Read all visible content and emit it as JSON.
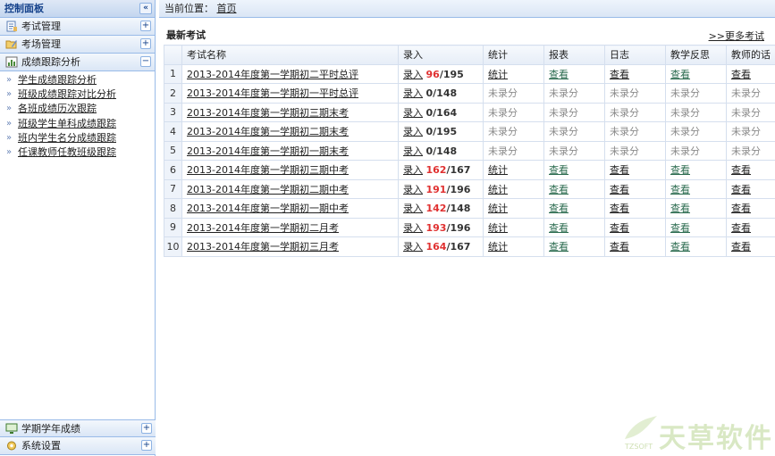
{
  "sidebar": {
    "header": "控制面板",
    "collapse_symbol": "«",
    "sections": [
      {
        "label": "考试管理",
        "toggle": "+"
      },
      {
        "label": "考场管理",
        "toggle": "+"
      },
      {
        "label": "成绩跟踪分析",
        "toggle": "−"
      }
    ],
    "links": [
      "学生成绩跟踪分析",
      "班级成绩跟踪对比分析",
      "各班成绩历次跟踪",
      "班级学生单科成绩跟踪",
      "班内学生名分成绩跟踪",
      "任课教师任教班级跟踪"
    ],
    "bottom_sections": [
      {
        "label": "学期学年成绩",
        "toggle": "+"
      },
      {
        "label": "系统设置",
        "toggle": "+"
      }
    ]
  },
  "breadcrumb": {
    "label": "当前位置：",
    "home": "首页"
  },
  "panel": {
    "title": "最新考试",
    "more_link": ">>更多考试"
  },
  "table": {
    "headers": [
      "考试名称",
      "录入",
      "统计",
      "报表",
      "日志",
      "教学反思",
      "教师的话"
    ],
    "rows": [
      {
        "num": "1",
        "name": "2013-2014年度第一学期初二平时总评",
        "entry": "录入",
        "done": "96",
        "total": "/195",
        "done_red": true,
        "stat": "统计",
        "report": "查看",
        "log": "查看",
        "reflect": "查看",
        "talk": "查看",
        "recorded": true
      },
      {
        "num": "2",
        "name": "2013-2014年度第一学期初一平时总评",
        "entry": "录入",
        "done": "0",
        "total": "/148",
        "done_red": false,
        "stat": "未录分",
        "report": "未录分",
        "log": "未录分",
        "reflect": "未录分",
        "talk": "未录分",
        "recorded": false
      },
      {
        "num": "3",
        "name": "2013-2014年度第一学期初三期末考",
        "entry": "录入",
        "done": "0",
        "total": "/164",
        "done_red": false,
        "stat": "未录分",
        "report": "未录分",
        "log": "未录分",
        "reflect": "未录分",
        "talk": "未录分",
        "recorded": false
      },
      {
        "num": "4",
        "name": "2013-2014年度第一学期初二期末考",
        "entry": "录入",
        "done": "0",
        "total": "/195",
        "done_red": false,
        "stat": "未录分",
        "report": "未录分",
        "log": "未录分",
        "reflect": "未录分",
        "talk": "未录分",
        "recorded": false
      },
      {
        "num": "5",
        "name": "2013-2014年度第一学期初一期末考",
        "entry": "录入",
        "done": "0",
        "total": "/148",
        "done_red": false,
        "stat": "未录分",
        "report": "未录分",
        "log": "未录分",
        "reflect": "未录分",
        "talk": "未录分",
        "recorded": false
      },
      {
        "num": "6",
        "name": "2013-2014年度第一学期初三期中考",
        "entry": "录入",
        "done": "162",
        "total": "/167",
        "done_red": true,
        "stat": "统计",
        "report": "查看",
        "log": "查看",
        "reflect": "查看",
        "talk": "查看",
        "recorded": true
      },
      {
        "num": "7",
        "name": "2013-2014年度第一学期初二期中考",
        "entry": "录入",
        "done": "191",
        "total": "/196",
        "done_red": true,
        "stat": "统计",
        "report": "查看",
        "log": "查看",
        "reflect": "查看",
        "talk": "查看",
        "recorded": true
      },
      {
        "num": "8",
        "name": "2013-2014年度第一学期初一期中考",
        "entry": "录入",
        "done": "142",
        "total": "/148",
        "done_red": true,
        "stat": "统计",
        "report": "查看",
        "log": "查看",
        "reflect": "查看",
        "talk": "查看",
        "recorded": true
      },
      {
        "num": "9",
        "name": "2013-2014年度第一学期初二月考",
        "entry": "录入",
        "done": "193",
        "total": "/196",
        "done_red": true,
        "stat": "统计",
        "report": "查看",
        "log": "查看",
        "reflect": "查看",
        "talk": "查看",
        "recorded": true
      },
      {
        "num": "10",
        "name": "2013-2014年度第一学期初三月考",
        "entry": "录入",
        "done": "164",
        "total": "/167",
        "done_red": true,
        "stat": "统计",
        "report": "查看",
        "log": "查看",
        "reflect": "查看",
        "talk": "查看",
        "recorded": true
      }
    ]
  },
  "watermark": {
    "text": "天草软件",
    "sub": "TZSOFT"
  },
  "colors": {
    "accent": "#15428b",
    "border": "#99bbe8",
    "count_red": "#e03131",
    "view_green": "#2b6b4f"
  }
}
